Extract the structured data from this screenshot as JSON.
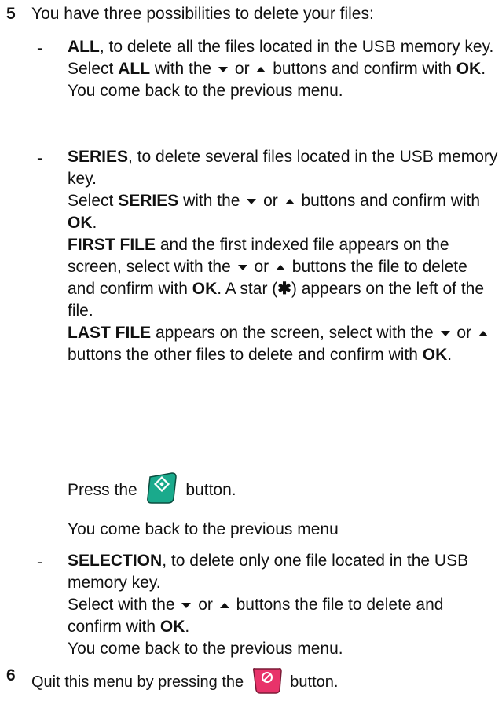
{
  "step5": {
    "number": "5",
    "intro": "You have three possibilities to delete your files:"
  },
  "all": {
    "dash": "-",
    "keyword": "ALL",
    "desc": ", to delete all the files located in the USB memory key.",
    "select_pre": "Select ",
    "select_kw": "ALL",
    "select_mid": " with the ",
    "or": " or ",
    "select_post": " buttons and confirm with ",
    "ok": "OK",
    "period": ".",
    "back": "You come back to the previous menu."
  },
  "series": {
    "dash": "-",
    "keyword": "SERIES",
    "desc": ", to delete several files located in the USB memory key.",
    "select_pre": "Select ",
    "select_kw": "SERIES",
    "select_mid": " with the ",
    "or": " or ",
    "select_post": " buttons and confirm with ",
    "ok": "OK",
    "period": ".",
    "first_kw": "FIRST FILE",
    "first_text": " and the first indexed file appears on the screen, select with the ",
    "first_or": " or ",
    "first_post": " buttons the file to delete and confirm with ",
    "first_ok": "OK",
    "star_pre": ". A star (",
    "star": "✱",
    "star_post": ") appears on the left of the file.",
    "last_kw": "LAST FILE",
    "last_text": " appears on the screen, select with the ",
    "last_or": " or ",
    "last_post": " buttons the other files to delete and confirm with ",
    "last_ok": "OK",
    "last_period": ".",
    "press_pre": "Press the ",
    "press_post": " button.",
    "back": "You come back to the previous menu",
    "start_button_color": "#1aaa8c"
  },
  "selection": {
    "dash": "-",
    "keyword": "SELECTION",
    "desc": ", to delete only one file located in the USB memory key.",
    "select_pre": "Select with the ",
    "or": " or ",
    "select_post": " buttons the file to delete and confirm with ",
    "ok": "OK",
    "period": ".",
    "back": "You come back to the previous menu."
  },
  "step6": {
    "number": "6",
    "text_pre": "Quit this menu by pressing the ",
    "text_post": " button.",
    "stop_button_color": "#e8336a"
  }
}
